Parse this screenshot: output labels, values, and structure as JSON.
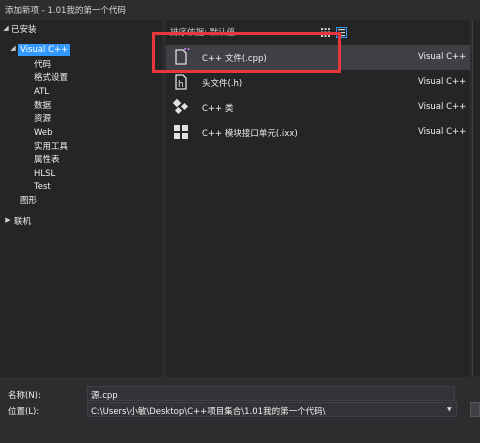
{
  "window": {
    "title": "添加新项 - 1.01我的第一个代码"
  },
  "tree": {
    "installed": "已安装",
    "visual_cpp": "Visual C++",
    "children": [
      "代码",
      "格式设置",
      "ATL",
      "数据",
      "资源",
      "Web",
      "实用工具",
      "属性表",
      "HLSL",
      "Test"
    ],
    "graphics": "图形",
    "online": "联机"
  },
  "sort": {
    "label": "排序依据: 默认值"
  },
  "items": [
    {
      "name": "C++ 文件(.cpp)",
      "lang": "Visual C++",
      "icon": "cpp-file-icon"
    },
    {
      "name": "头文件(.h)",
      "lang": "Visual C++",
      "icon": "header-file-icon"
    },
    {
      "name": "C++ 类",
      "lang": "Visual C++",
      "icon": "class-icon"
    },
    {
      "name": "C++ 模块接口单元(.ixx)",
      "lang": "Visual C++",
      "icon": "module-icon"
    }
  ],
  "form": {
    "name_label": "名称(N):",
    "name_value": "源.cpp",
    "location_label": "位置(L):",
    "location_value": "C:\\Users\\小敏\\Desktop\\C++项目集合\\1.01我的第一个代码\\"
  },
  "colors": {
    "highlight": "#e8363d",
    "accent": "#3399ff"
  }
}
